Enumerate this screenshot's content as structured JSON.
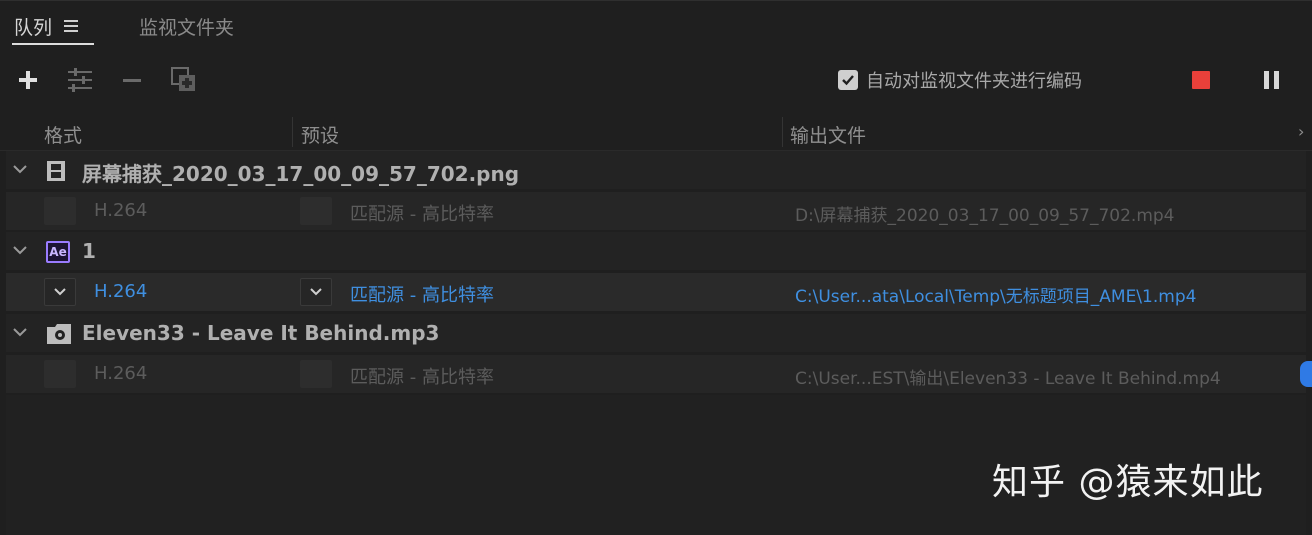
{
  "tabs": [
    {
      "label": "队列",
      "active": true
    },
    {
      "label": "监视文件夹",
      "active": false
    }
  ],
  "toolbar": {
    "auto_encode_label": "自动对监视文件夹进行编码",
    "auto_encode_checked": true,
    "stop_color": "#e8403a"
  },
  "columns": {
    "format": "格式",
    "preset": "预设",
    "output": "输出文件",
    "more": "›"
  },
  "queue": [
    {
      "name": "屏幕捕获_2020_03_17_00_09_57_702.png",
      "icon": "film-strip-icon",
      "output": {
        "format": "H.264",
        "preset": "匹配源 - 高比特率",
        "path": "D:\\屏幕捕获_2020_03_17_00_09_57_702.mp4",
        "state": "inactive"
      }
    },
    {
      "name": "1",
      "icon": "after-effects-icon",
      "icon_text": "Ae",
      "output": {
        "format": "H.264",
        "preset": "匹配源 - 高比特率",
        "path": "C:\\User...ata\\Local\\Temp\\无标题项目_AME\\1.mp4",
        "state": "active"
      }
    },
    {
      "name": "Eleven33 - Leave It Behind.mp3",
      "icon": "audio-file-icon",
      "output": {
        "format": "H.264",
        "preset": "匹配源 - 高比特率",
        "path": "C:\\User...EST\\输出\\Eleven33 - Leave It Behind.mp4",
        "state": "inactive"
      }
    }
  ],
  "watermark": "知乎 @猿来如此",
  "colors": {
    "accent": "#3f8fe0",
    "ae_purple": "#9a7cff",
    "background": "#1f1f1f"
  }
}
